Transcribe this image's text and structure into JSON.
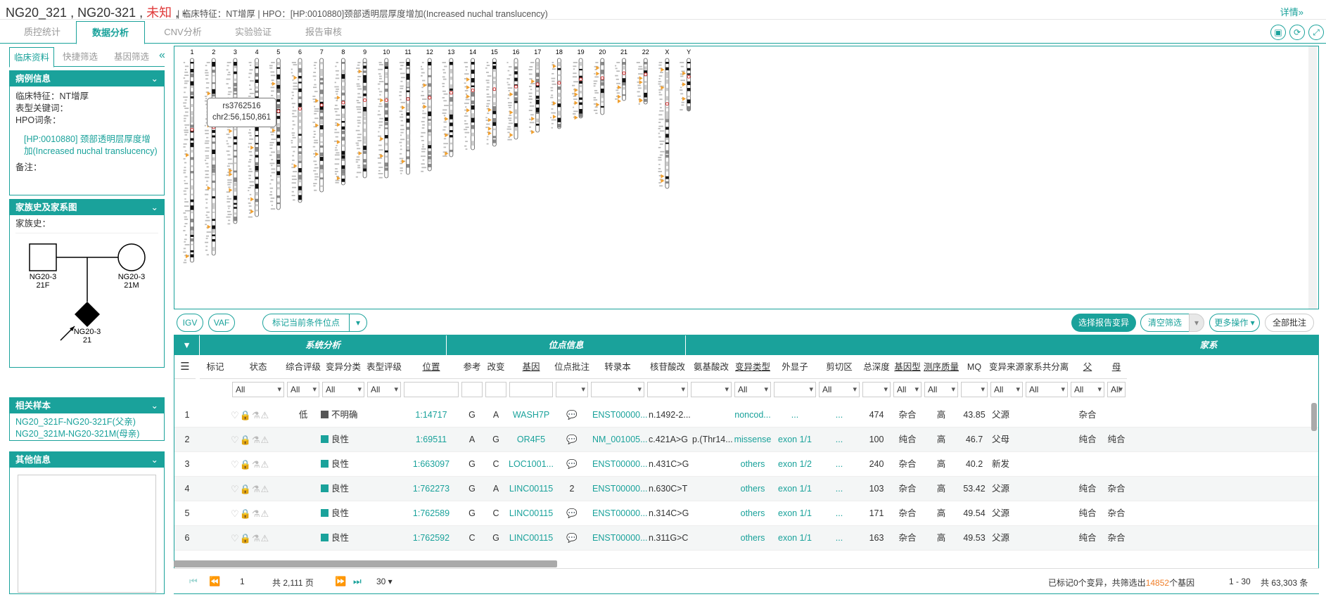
{
  "header": {
    "sample_id_1": "NG20_321",
    "sample_id_2": "NG20-321",
    "unknown": "未知",
    "dash": "-",
    "clinical_label": "临床特征：",
    "clinical_value": "NT增厚",
    "hpo_label": "HPO：",
    "hpo_value": "[HP:0010880]颈部透明层厚度增加(Increased nuchal translucency)",
    "details_link": "详情»"
  },
  "main_tabs": [
    "质控统计",
    "数据分析",
    "CNV分析",
    "实验验证",
    "报告审核"
  ],
  "left_tabs": [
    "临床资料",
    "快捷筛选",
    "基因筛选"
  ],
  "case_panel": {
    "title": "病例信息",
    "clinical_label": "临床特征：",
    "clinical_value": "NT增厚",
    "phenotype_label": "表型关键词：",
    "hpo_label": "HPO词条：",
    "hpo_link": "[HP:0010880] 颈部透明层厚度增加(Increased nuchal translucency)",
    "note_label": "备注："
  },
  "family_panel": {
    "title": "家族史及家系图",
    "history_label": "家族史：",
    "father_label_1": "NG20-3",
    "father_label_2": "21F",
    "mother_label_1": "NG20-3",
    "mother_label_2": "21M",
    "proband_label_1": "NG20-3",
    "proband_label_2": "21"
  },
  "related_panel": {
    "title": "相关样本",
    "items": [
      "NG20_321F-NG20-321F(父亲)",
      "NG20_321M-NG20-321M(母亲)"
    ]
  },
  "other_panel": {
    "title": "其他信息"
  },
  "chromosomes": [
    "1",
    "2",
    "3",
    "4",
    "5",
    "6",
    "7",
    "8",
    "9",
    "10",
    "11",
    "12",
    "13",
    "14",
    "15",
    "16",
    "17",
    "18",
    "19",
    "20",
    "21",
    "22",
    "X",
    "Y"
  ],
  "tooltip": {
    "rsid": "rs3762516",
    "pos": "chr2:56,150,861"
  },
  "toolbar": {
    "igv": "IGV",
    "vaf": "VAF",
    "mark": "标记当前条件位点",
    "select_report": "选择报告变异",
    "clear_filter": "清空筛选",
    "more_ops": "更多操作",
    "all_notes": "全部批注"
  },
  "group_headers": {
    "system": "系统分析",
    "site": "位点信息",
    "family": "家系"
  },
  "columns": [
    "标记",
    "状态",
    "综合评级",
    "变异分类",
    "表型评级",
    "位置",
    "参考",
    "改变",
    "基因",
    "位点批注",
    "转录本",
    "核苷酸改变",
    "氨基酸改变",
    "变异类型",
    "外显子",
    "剪切区",
    "总深度",
    "基因型",
    "测序质量",
    "MQ",
    "变异来源",
    "家系共分离",
    "父",
    "母"
  ],
  "filter_all": "All",
  "rows": [
    {
      "n": "1",
      "rating": "低",
      "cls": "不明确",
      "cls_color": "#555555",
      "pos": "1:14717",
      "ref": "G",
      "alt": "A",
      "gene": "WASH7P",
      "note": "",
      "tx": "ENST00000...",
      "nt": "n.1492-2...",
      "aa": "",
      "type": "noncod...",
      "exon": "...",
      "splice": "...",
      "depth": "474",
      "gt": "杂合",
      "qual": "高",
      "mq": "43.85",
      "src": "父源",
      "fa": "杂合",
      "mo": ""
    },
    {
      "n": "2",
      "rating": "",
      "cls": "良性",
      "cls_color": "#1aa29b",
      "pos": "1:69511",
      "ref": "A",
      "alt": "G",
      "gene": "OR4F5",
      "note": "",
      "tx": "NM_001005...",
      "nt": "c.421A>G",
      "aa": "p.(Thr14...",
      "type": "missense",
      "exon": "exon 1/1",
      "splice": "...",
      "depth": "100",
      "gt": "纯合",
      "qual": "高",
      "mq": "46.7",
      "src": "父母",
      "fa": "纯合",
      "mo": "纯合"
    },
    {
      "n": "3",
      "rating": "",
      "cls": "良性",
      "cls_color": "#1aa29b",
      "pos": "1:663097",
      "ref": "G",
      "alt": "C",
      "gene": "LOC1001...",
      "note": "",
      "tx": "ENST00000...",
      "nt": "n.431C>G",
      "aa": "",
      "type": "others",
      "exon": "exon 1/2",
      "splice": "...",
      "depth": "240",
      "gt": "杂合",
      "qual": "高",
      "mq": "40.2",
      "src": "新发",
      "fa": "",
      "mo": ""
    },
    {
      "n": "4",
      "rating": "",
      "cls": "良性",
      "cls_color": "#1aa29b",
      "pos": "1:762273",
      "ref": "G",
      "alt": "A",
      "gene": "LINC00115",
      "note": "2",
      "tx": "ENST00000...",
      "nt": "n.630C>T",
      "aa": "",
      "type": "others",
      "exon": "exon 1/1",
      "splice": "...",
      "depth": "103",
      "gt": "杂合",
      "qual": "高",
      "mq": "53.42",
      "src": "父源",
      "fa": "纯合",
      "mo": "杂合"
    },
    {
      "n": "5",
      "rating": "",
      "cls": "良性",
      "cls_color": "#1aa29b",
      "pos": "1:762589",
      "ref": "G",
      "alt": "C",
      "gene": "LINC00115",
      "note": "",
      "tx": "ENST00000...",
      "nt": "n.314C>G",
      "aa": "",
      "type": "others",
      "exon": "exon 1/1",
      "splice": "...",
      "depth": "171",
      "gt": "杂合",
      "qual": "高",
      "mq": "49.54",
      "src": "父源",
      "fa": "纯合",
      "mo": "杂合"
    },
    {
      "n": "6",
      "rating": "",
      "cls": "良性",
      "cls_color": "#1aa29b",
      "pos": "1:762592",
      "ref": "C",
      "alt": "G",
      "gene": "LINC00115",
      "note": "",
      "tx": "ENST00000...",
      "nt": "n.311G>C",
      "aa": "",
      "type": "others",
      "exon": "exon 1/1",
      "splice": "...",
      "depth": "163",
      "gt": "杂合",
      "qual": "高",
      "mq": "49.53",
      "src": "父源",
      "fa": "纯合",
      "mo": "杂合"
    }
  ],
  "footer": {
    "page": "1",
    "total_pages": "共 2,111 页",
    "page_size": "30 ▾",
    "summary_pre": "已标记0个变异，共筛选出",
    "gene_count": "14852",
    "summary_post": "个基因",
    "range": "1 - 30",
    "total": "共 63,303 条"
  }
}
